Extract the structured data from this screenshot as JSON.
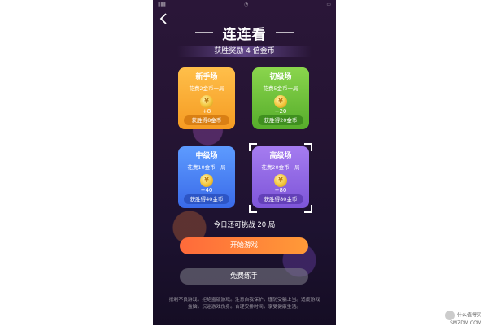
{
  "header": {
    "back_icon": "chevron-left-icon",
    "title": "连连看"
  },
  "banner": "获胜奖励 4 倍金币",
  "rooms": [
    {
      "name": "新手场",
      "cost": "花费2金币一局",
      "reward": "+8",
      "win": "获胜得8金币",
      "color": "#f7a52b"
    },
    {
      "name": "初级场",
      "cost": "花费5金币一局",
      "reward": "+20",
      "win": "获胜得20金币",
      "color": "#6cc03a"
    },
    {
      "name": "中级场",
      "cost": "花费10金币一局",
      "reward": "+40",
      "win": "获胜得40金币",
      "color": "#4a82f5"
    },
    {
      "name": "高级场",
      "cost": "花费20金币一局",
      "reward": "+80",
      "win": "获胜得80金币",
      "color": "#8f68e4"
    }
  ],
  "daily_remaining": "今日还可挑战 20 局",
  "buttons": {
    "start": "开始游戏",
    "practice": "免费练手"
  },
  "notice": "抵制不良游戏，拒绝盗版游戏。注意自我保护，谨防受骗上当。适度游戏益脑，沉迷游戏伤身。合理安排时间，享受健康生活。",
  "watermark": {
    "line1": "什么值得买",
    "line2": "SMZDM.COM"
  }
}
